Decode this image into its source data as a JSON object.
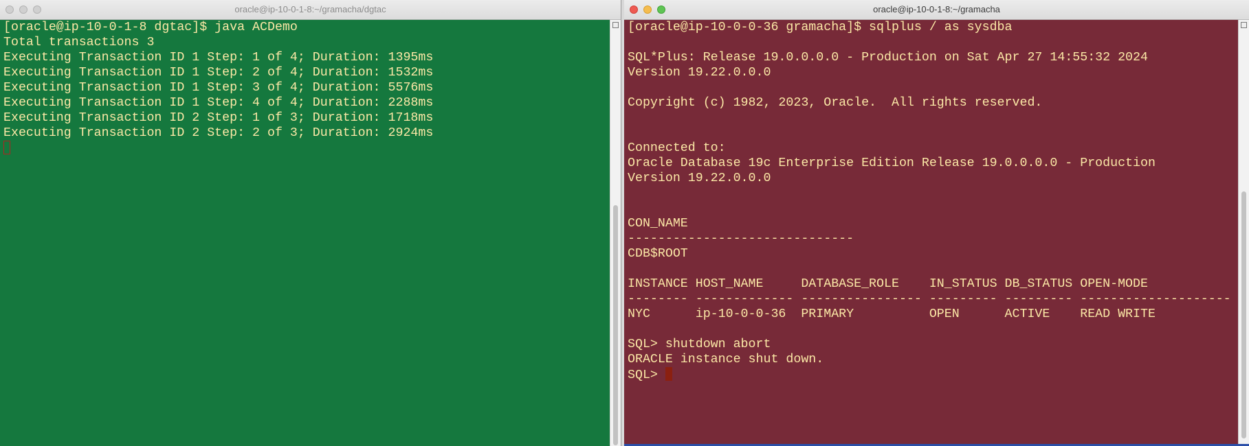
{
  "left_window": {
    "title": "oracle@ip-10-0-1-8:~/gramacha/dgtac",
    "lines": [
      "[oracle@ip-10-0-1-8 dgtac]$ java ACDemo",
      "Total transactions 3",
      "Executing Transaction ID 1 Step: 1 of 4; Duration: 1395ms",
      "Executing Transaction ID 1 Step: 2 of 4; Duration: 1532ms",
      "Executing Transaction ID 1 Step: 3 of 4; Duration: 5576ms",
      "Executing Transaction ID 1 Step: 4 of 4; Duration: 2288ms",
      "Executing Transaction ID 2 Step: 1 of 3; Duration: 1718ms",
      "Executing Transaction ID 2 Step: 2 of 3; Duration: 2924ms"
    ],
    "prompt": ""
  },
  "right_window": {
    "title": "oracle@ip-10-0-1-8:~/gramacha",
    "lines": [
      "[oracle@ip-10-0-0-36 gramacha]$ sqlplus / as sysdba",
      "",
      "SQL*Plus: Release 19.0.0.0.0 - Production on Sat Apr 27 14:55:32 2024",
      "Version 19.22.0.0.0",
      "",
      "Copyright (c) 1982, 2023, Oracle.  All rights reserved.",
      "",
      "",
      "Connected to:",
      "Oracle Database 19c Enterprise Edition Release 19.0.0.0.0 - Production",
      "Version 19.22.0.0.0",
      "",
      "",
      "CON_NAME",
      "------------------------------",
      "CDB$ROOT",
      "",
      "INSTANCE HOST_NAME     DATABASE_ROLE    IN_STATUS DB_STATUS OPEN-MODE",
      "-------- ------------- ---------------- --------- --------- --------------------",
      "NYC      ip-10-0-0-36  PRIMARY          OPEN      ACTIVE    READ WRITE",
      "",
      "SQL> shutdown abort",
      "ORACLE instance shut down."
    ],
    "prompt": "SQL> "
  },
  "colors": {
    "left_bg": "#15783e",
    "right_bg": "#772a38",
    "text": "#fbe8a6"
  }
}
